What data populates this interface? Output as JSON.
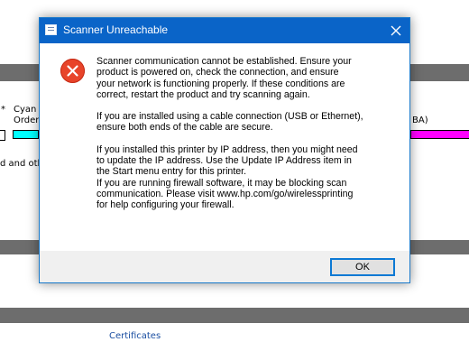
{
  "background": {
    "asterisk": "*",
    "cyan_label": "Cyan",
    "order_label": "Order",
    "abbrev": "BA)",
    "and_other": "d and oth",
    "certificates_link": "Certificates",
    "colors": {
      "bar": "#6d6d6d",
      "cyan": "#00ffff",
      "magenta": "#ff00ff"
    }
  },
  "dialog": {
    "title": "Scanner Unreachable",
    "close_icon": "close-icon",
    "error_icon": "error-icon",
    "paragraph1": [
      "Scanner communication cannot be established.  Ensure your",
      "product is powered on, check the connection, and ensure",
      "your network is functioning properly.  If these conditions are",
      "correct, restart the product and try scanning again."
    ],
    "paragraph2": [
      "If you are installed using a cable connection (USB or Ethernet),",
      "ensure both ends of the cable are secure."
    ],
    "paragraph3": [
      "If you installed this printer by IP address, then you might need",
      "to update the IP address.  Use the Update IP Address item in",
      "the Start menu entry for this printer.",
      "If you are running firewall software, it may be blocking scan",
      "communication.  Please visit www.hp.com/go/wirelessprinting",
      "for help configuring your firewall."
    ],
    "ok_label": "OK",
    "colors": {
      "titlebar": "#0a64c8",
      "error": "#e8442a",
      "ok_border": "#0c79d4"
    }
  }
}
